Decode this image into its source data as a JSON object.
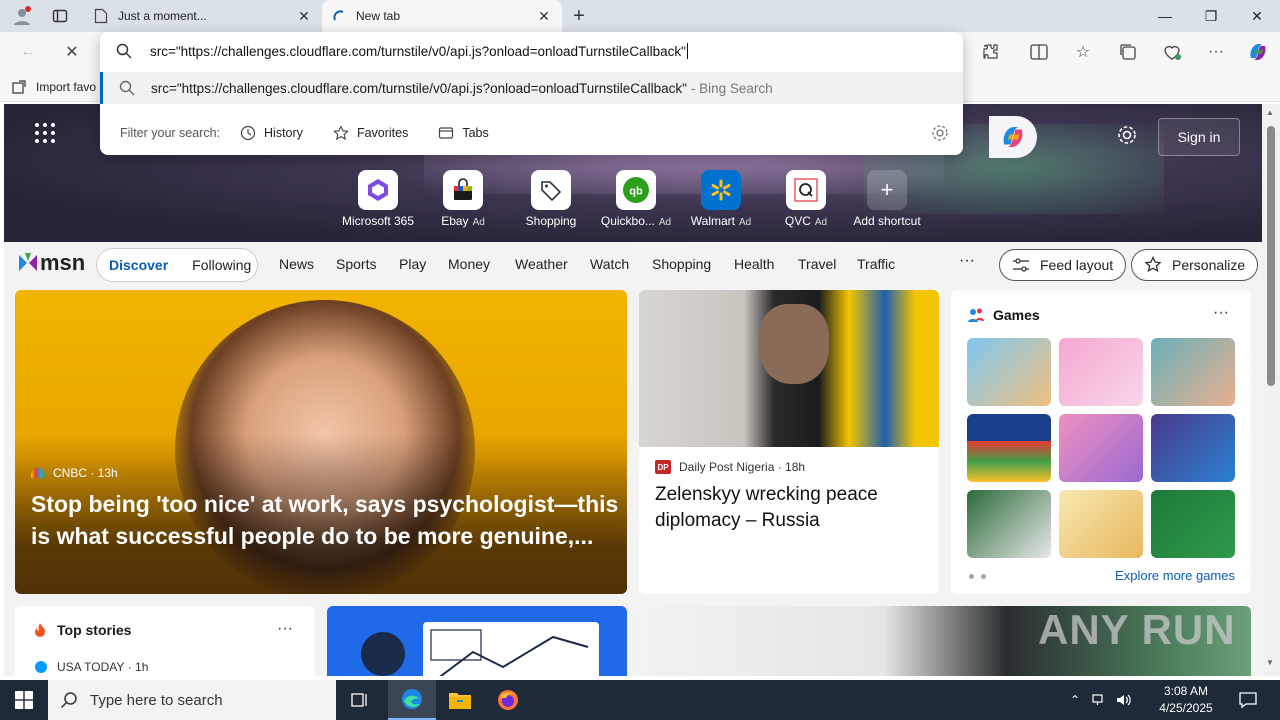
{
  "browser": {
    "tabs": [
      {
        "title": "Just a moment...",
        "active": false
      },
      {
        "title": "New tab",
        "active": true
      }
    ],
    "address_query": "src=\"https://challenges.cloudflare.com/turnstile/v0/api.js?onload=onloadTurnstileCallback\"",
    "suggestion_query": "src=\"https://challenges.cloudflare.com/turnstile/v0/api.js?onload=onloadTurnstileCallback\"",
    "suggestion_source": "- Bing Search",
    "filter_label": "Filter your search:",
    "filters": [
      "History",
      "Favorites",
      "Tabs"
    ],
    "favorites_bar_item": "Import favo"
  },
  "hero": {
    "signin_label": "Sign in",
    "shortcuts": [
      {
        "label": "Microsoft 365",
        "ad": "",
        "icon": "microsoft-365-icon"
      },
      {
        "label": "Ebay",
        "ad": "Ad",
        "icon": "ebay-icon"
      },
      {
        "label": "Shopping",
        "ad": "",
        "icon": "shopping-tag-icon"
      },
      {
        "label": "Quickbo...",
        "ad": "Ad",
        "icon": "quickbooks-icon"
      },
      {
        "label": "Walmart",
        "ad": "Ad",
        "icon": "walmart-icon"
      },
      {
        "label": "QVC",
        "ad": "Ad",
        "icon": "qvc-icon"
      },
      {
        "label": "Add shortcut",
        "ad": "",
        "icon": "plus-icon"
      }
    ]
  },
  "msn_nav": {
    "logo": "msn",
    "segments": [
      "Discover",
      "Following"
    ],
    "links": [
      "News",
      "Sports",
      "Play",
      "Money",
      "Weather",
      "Watch",
      "Shopping",
      "Health",
      "Travel",
      "Traffic"
    ],
    "more": "···",
    "feed_layout": "Feed layout",
    "personalize": "Personalize"
  },
  "cards": {
    "big": {
      "source": "CNBC",
      "age": "· 13h",
      "headline": "Stop being 'too nice' at work, says psychologist—this is what successful people do to be more genuine,..."
    },
    "mid": {
      "badge": "DP",
      "source": "Daily Post Nigeria",
      "age": "· 18h",
      "headline": "Zelenskyy wrecking peace diplomacy – Russia"
    },
    "games": {
      "title": "Games",
      "more": "···",
      "explore": "Explore more games"
    },
    "top_stories": {
      "title": "Top stories",
      "more": "···",
      "source": "USA TODAY",
      "age": "· 1h"
    }
  },
  "watermark": "ANY RUN",
  "taskbar": {
    "search_placeholder": "Type here to search",
    "time": "3:08 AM",
    "date": "4/25/2025"
  },
  "colors": {
    "accent": "#0a5cb8",
    "taskbar": "#1f2a38",
    "tabstrip": "#dbe1e9"
  }
}
